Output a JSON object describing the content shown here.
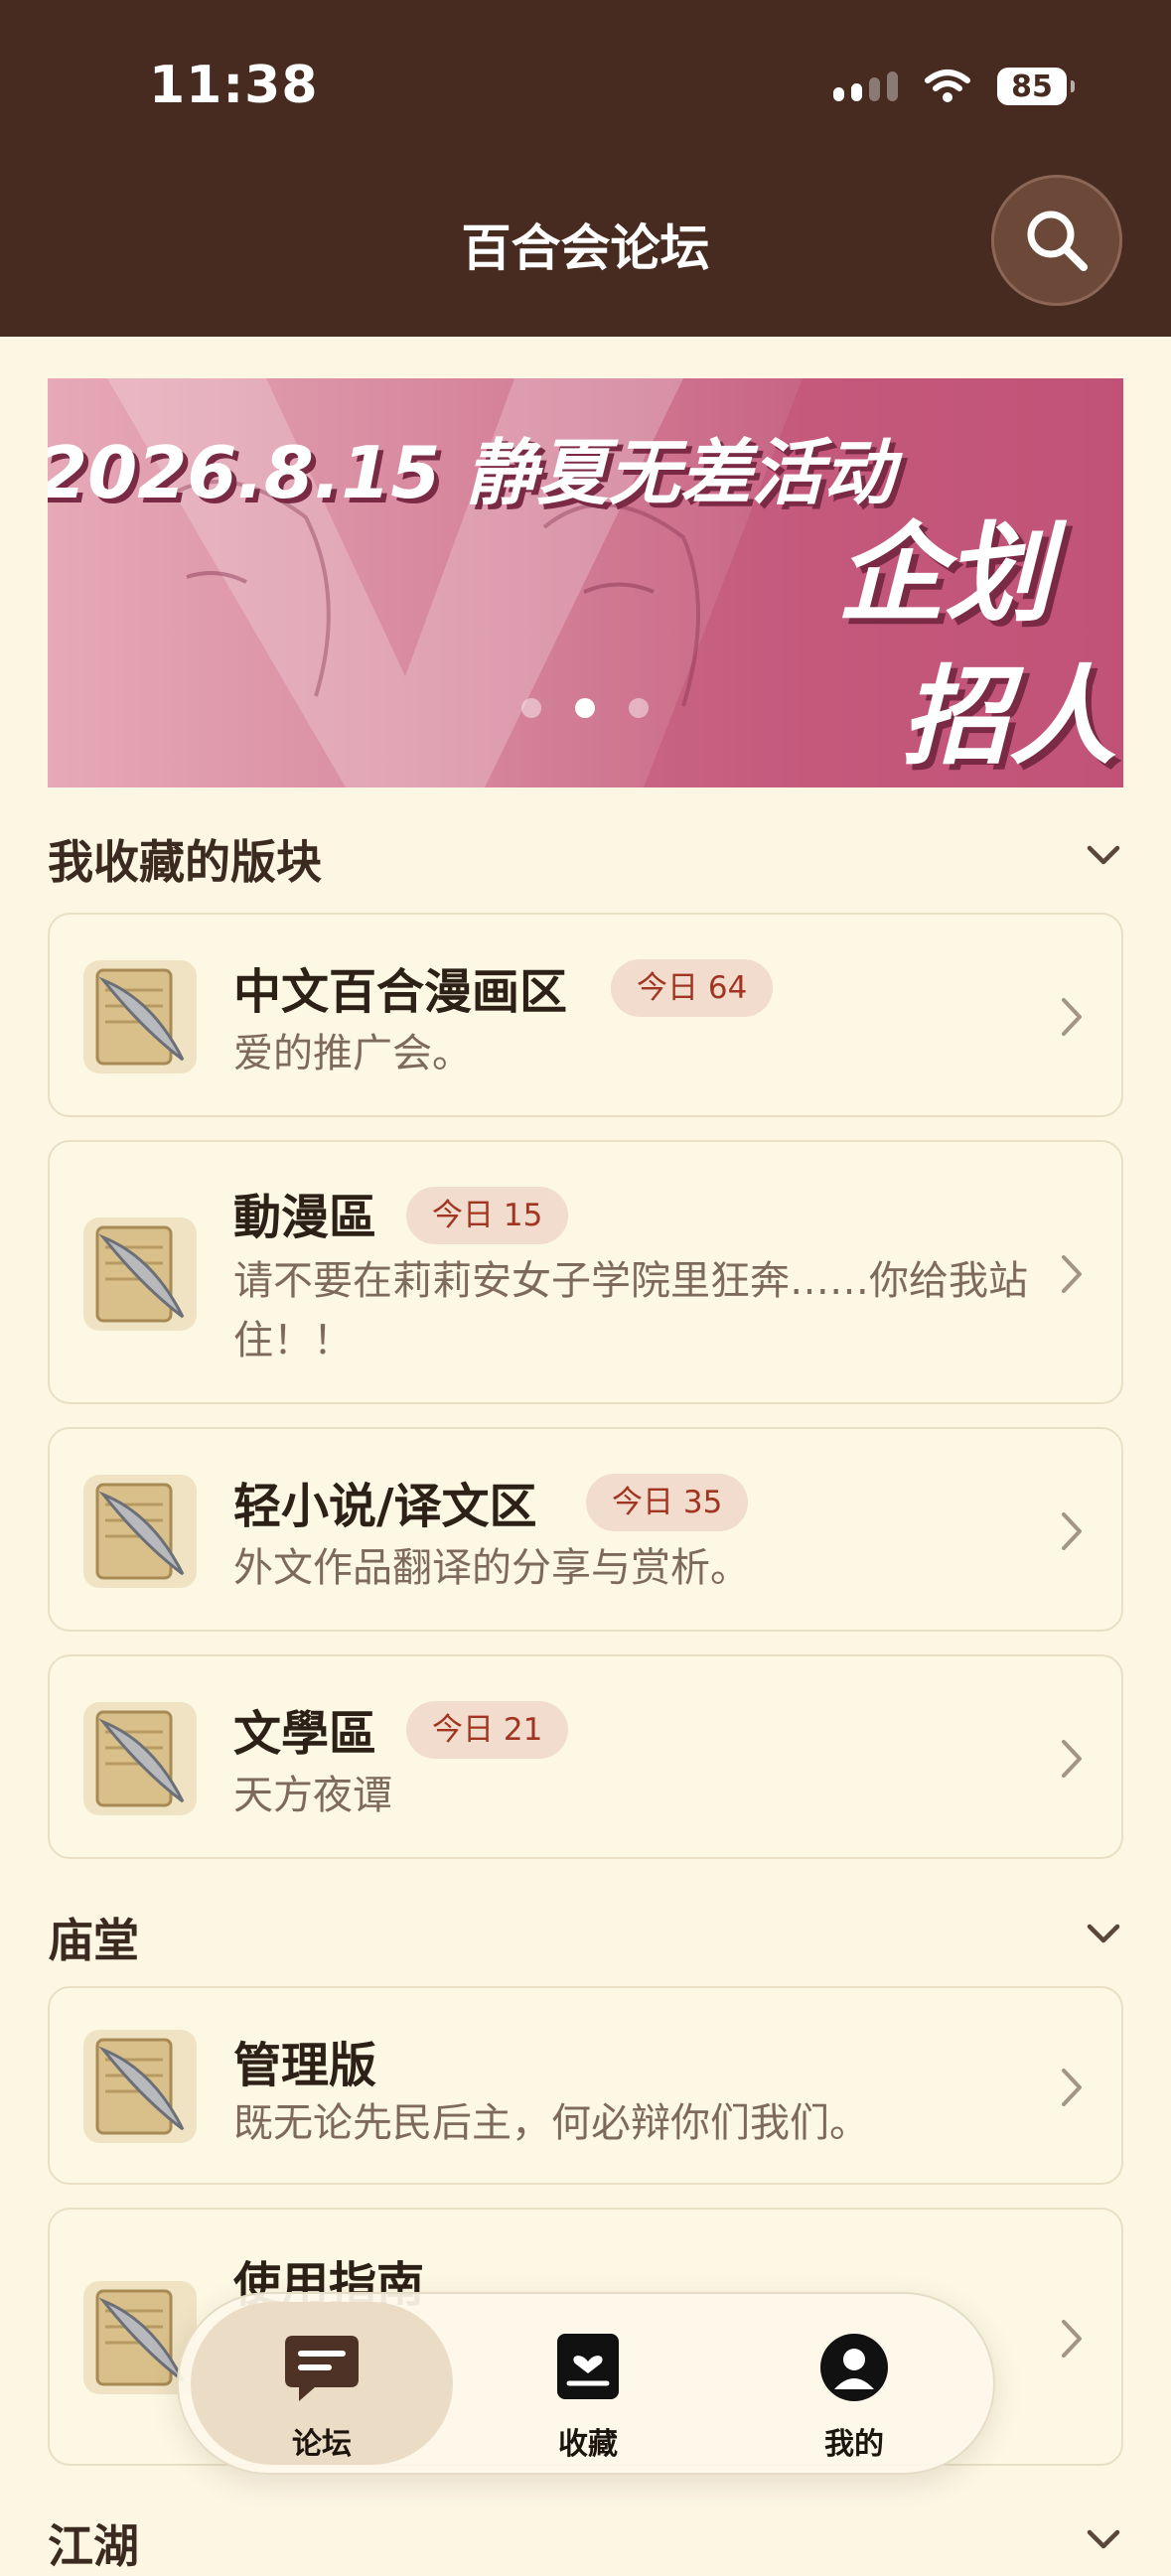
{
  "status_bar": {
    "time": "11:38",
    "battery": "85"
  },
  "header": {
    "title": "百合会论坛"
  },
  "banner": {
    "line1": "2026.8.15 静夏无差活动",
    "line2": "企划",
    "line3": "招人",
    "slide_index": 2,
    "slide_count": 3
  },
  "sections": [
    {
      "title": "我收藏的版块",
      "boards": [
        {
          "name": "中文百合漫画区",
          "badge": "今日 64",
          "desc": "爱的推广会。"
        },
        {
          "name": "動漫區",
          "badge": "今日 15",
          "desc": "请不要在莉莉安女子学院里狂奔……你给我站住！！"
        },
        {
          "name": "轻小说/译文区",
          "badge": "今日 35",
          "desc": "外文作品翻译的分享与赏析。"
        },
        {
          "name": "文學區",
          "badge": "今日 21",
          "desc": "天方夜谭"
        }
      ]
    },
    {
      "title": "庙堂",
      "boards": [
        {
          "name": "管理版",
          "desc": "既无论先民后主，何必辩你们我们。"
        },
        {
          "name": "使用指南"
        }
      ]
    },
    {
      "title": "江湖"
    }
  ],
  "tabbar": {
    "tabs": [
      {
        "label": "论坛",
        "icon": "chat-bubble-icon",
        "active": true
      },
      {
        "label": "收藏",
        "icon": "bookmark-heart-icon",
        "active": false
      },
      {
        "label": "我的",
        "icon": "user-icon",
        "active": false
      }
    ]
  },
  "colors": {
    "header_bg": "#472b20",
    "page_bg": "#fdf6e3",
    "badge_bg": "#f1dccd",
    "badge_text": "#a23522"
  }
}
